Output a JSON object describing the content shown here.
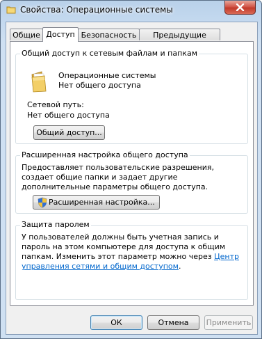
{
  "window": {
    "title": "Свойства: Операционные системы"
  },
  "tabs": [
    {
      "label": "Общие",
      "active": false
    },
    {
      "label": "Доступ",
      "active": true
    },
    {
      "label": "Безопасность",
      "active": false
    },
    {
      "label": "Предыдущие версии",
      "active": false
    }
  ],
  "network_sharing": {
    "group_title": "Общий доступ к сетевым файлам и папкам",
    "folder_name": "Операционные системы",
    "folder_status": "Нет общего доступа",
    "network_path_label": "Сетевой путь:",
    "network_path_value": "Нет общего доступа",
    "share_button": "Общий доступ..."
  },
  "advanced_sharing": {
    "group_title": "Расширенная настройка общего доступа",
    "description": "Предоставляет пользовательские разрешения, создает общие папки и задает другие дополнительные параметры общего доступа.",
    "button": "Расширенная настройка..."
  },
  "password_protection": {
    "group_title": "Защита паролем",
    "text_part1": "У пользователей должны быть учетная запись и пароль на этом компьютере для доступа к общим папкам. Изменить этот параметр можно через ",
    "link_text": "Центр управления сетями и общим доступом",
    "text_part2": "."
  },
  "footer": {
    "ok": "ОК",
    "cancel": "Отмена",
    "apply": "Применить"
  },
  "icons": {
    "title": "folder-icon",
    "close": "close-icon",
    "folder": "folder-icon",
    "shield": "uac-shield-icon"
  },
  "colors": {
    "link": "#0066cc",
    "close_button": "#c23a2b",
    "title_bar": "#b9d1ea"
  }
}
